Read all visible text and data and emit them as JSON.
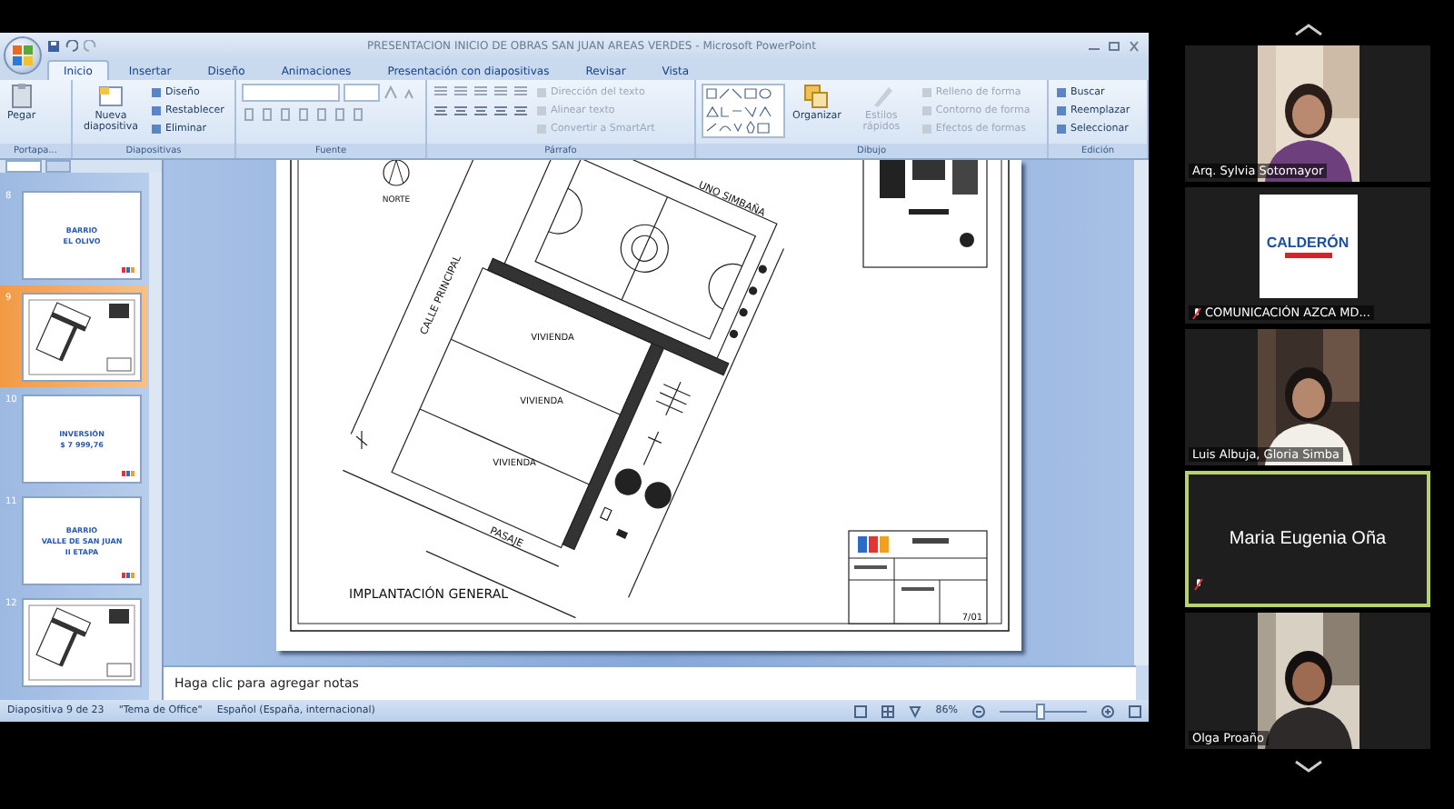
{
  "window": {
    "title": "PRESENTACION INICIO DE OBRAS SAN JUAN AREAS VERDES - Microsoft PowerPoint"
  },
  "tabs": [
    {
      "label": "Inicio",
      "selected": true
    },
    {
      "label": "Insertar",
      "selected": false
    },
    {
      "label": "Diseño",
      "selected": false
    },
    {
      "label": "Animaciones",
      "selected": false
    },
    {
      "label": "Presentación con diapositivas",
      "selected": false
    },
    {
      "label": "Revisar",
      "selected": false
    },
    {
      "label": "Vista",
      "selected": false
    }
  ],
  "ribbon_groups": [
    {
      "label": "Portapa...",
      "items": [
        {
          "kind": "large",
          "label": "Pegar",
          "disabled": false
        }
      ]
    },
    {
      "label": "Diapositivas",
      "items": [
        {
          "kind": "large",
          "label": "Nueva diapositiva",
          "disabled": false
        },
        {
          "kind": "small",
          "label": "Diseño",
          "disabled": false
        },
        {
          "kind": "small",
          "label": "Restablecer",
          "disabled": false
        },
        {
          "kind": "small",
          "label": "Eliminar",
          "disabled": false
        }
      ]
    },
    {
      "label": "Fuente",
      "items": [
        {
          "kind": "font"
        }
      ]
    },
    {
      "label": "Párrafo",
      "items": [
        {
          "kind": "paragraph"
        },
        {
          "kind": "small",
          "label": "Dirección del texto",
          "disabled": true
        },
        {
          "kind": "small",
          "label": "Alinear texto",
          "disabled": true
        },
        {
          "kind": "small",
          "label": "Convertir a SmartArt",
          "disabled": true
        }
      ]
    },
    {
      "label": "Dibujo",
      "items": [
        {
          "kind": "shapes"
        },
        {
          "kind": "large",
          "label": "Organizar",
          "disabled": false
        },
        {
          "kind": "large",
          "label": "Estilos rápidos",
          "disabled": true
        },
        {
          "kind": "small",
          "label": "Relleno de forma",
          "disabled": true
        },
        {
          "kind": "small",
          "label": "Contorno de forma",
          "disabled": true
        },
        {
          "kind": "small",
          "label": "Efectos de formas",
          "disabled": true
        }
      ]
    },
    {
      "label": "Edición",
      "items": [
        {
          "kind": "small",
          "label": "Buscar",
          "disabled": false
        },
        {
          "kind": "small",
          "label": "Reemplazar",
          "disabled": false
        },
        {
          "kind": "small",
          "label": "Seleccionar",
          "disabled": false
        }
      ]
    }
  ],
  "slides": [
    {
      "number": "8",
      "kind": "title",
      "lines": [
        "BARRIO",
        "EL OLIVO"
      ],
      "selected": false
    },
    {
      "number": "9",
      "kind": "plan",
      "selected": true
    },
    {
      "number": "10",
      "kind": "title",
      "lines": [
        "INVERSIÓN",
        "$ 7 999,76"
      ],
      "selected": false
    },
    {
      "number": "11",
      "kind": "title",
      "lines": [
        "BARRIO",
        "VALLE DE SAN JUAN",
        "II ETAPA"
      ],
      "selected": false
    },
    {
      "number": "12",
      "kind": "plan",
      "selected": false
    }
  ],
  "slide": {
    "labels": [
      "NORTE",
      "UNO SIMBAÑA",
      "CALLE PRINCIPAL",
      "VIVIENDA",
      "VIVIENDA",
      "VIVIENDA",
      "PASAJE",
      "IMPLANTACIÓN GENERAL",
      "7/01"
    ]
  },
  "notes": {
    "placeholder": "Haga clic para agregar notas"
  },
  "status_bar": {
    "slide_position": "Diapositiva 9 de 23",
    "theme": "\"Tema de Office\"",
    "language": "Español (España, internacional)",
    "zoom": "86%",
    "zoom_slider": {
      "level": 0.46
    }
  },
  "participants": [
    {
      "name": "Arq. Sylvia Sotomayor",
      "kind": "video",
      "muted": false,
      "selected": false
    },
    {
      "name": "COMUNICACIÓN AZCA MD...",
      "kind": "logo",
      "logo_text": "CALDERÓN",
      "muted": true,
      "selected": false
    },
    {
      "name": "Luis Albuja, Gloria Simba",
      "kind": "video",
      "muted": false,
      "selected": false
    },
    {
      "name": "Maria Eugenia Oña",
      "kind": "name_only",
      "muted": true,
      "selected": true
    },
    {
      "name": "Olga Proaño",
      "kind": "video",
      "muted": false,
      "selected": false
    }
  ]
}
